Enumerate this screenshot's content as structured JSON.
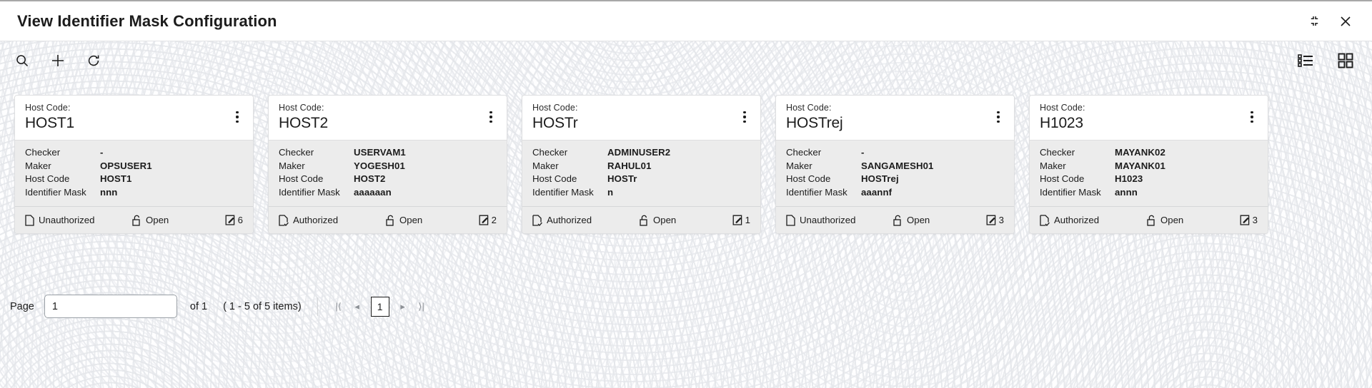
{
  "window": {
    "title": "View Identifier Mask Configuration",
    "actions": [
      {
        "name": "minimize-expand-icon",
        "label": "Minimize"
      },
      {
        "name": "close-icon",
        "label": "Close"
      }
    ]
  },
  "toolbar": {
    "left_tools": [
      {
        "name": "search-icon",
        "label": "Search"
      },
      {
        "name": "add-icon",
        "label": "Add"
      },
      {
        "name": "refresh-icon",
        "label": "Refresh"
      }
    ],
    "right_tools": [
      {
        "name": "list-view-icon",
        "label": "List View"
      },
      {
        "name": "grid-view-icon",
        "label": "Grid View"
      }
    ]
  },
  "cards": {
    "head_label": "Host Code:",
    "field_labels": {
      "checker": "Checker",
      "maker": "Maker",
      "host_code": "Host Code",
      "identifier_mask": "Identifier Mask"
    },
    "items": [
      {
        "title": "HOST1",
        "checker": "-",
        "maker": "OPSUSER1",
        "host_code": "HOST1",
        "identifier_mask": "nnn",
        "status": "Unauthorized",
        "status_icon": "document-icon",
        "lock": "Open",
        "lock_icon": "unlock-icon",
        "version": "6",
        "version_icon": "edit-icon"
      },
      {
        "title": "HOST2",
        "checker": "USERVAM1",
        "maker": "YOGESH01",
        "host_code": "HOST2",
        "identifier_mask": "aaaaaan",
        "status": "Authorized",
        "status_icon": "document-check-icon",
        "lock": "Open",
        "lock_icon": "unlock-icon",
        "version": "2",
        "version_icon": "edit-icon"
      },
      {
        "title": "HOSTr",
        "checker": "ADMINUSER2",
        "maker": "RAHUL01",
        "host_code": "HOSTr",
        "identifier_mask": "n",
        "status": "Authorized",
        "status_icon": "document-check-icon",
        "lock": "Open",
        "lock_icon": "unlock-icon",
        "version": "1",
        "version_icon": "edit-icon"
      },
      {
        "title": "HOSTrej",
        "checker": "-",
        "maker": "SANGAMESH01",
        "host_code": "HOSTrej",
        "identifier_mask": "aaannf",
        "status": "Unauthorized",
        "status_icon": "document-icon",
        "lock": "Open",
        "lock_icon": "unlock-icon",
        "version": "3",
        "version_icon": "edit-icon"
      },
      {
        "title": "H1023",
        "checker": "MAYANK02",
        "maker": "MAYANK01",
        "host_code": "H1023",
        "identifier_mask": "annn",
        "status": "Authorized",
        "status_icon": "document-check-icon",
        "lock": "Open",
        "lock_icon": "unlock-icon",
        "version": "3",
        "version_icon": "edit-icon"
      }
    ]
  },
  "pagination": {
    "page_label": "Page",
    "page_value": "1",
    "of_text": "of 1",
    "items_text": "( 1 - 5 of 5 items)",
    "current_page": "1",
    "nav": {
      "first": "|⟨",
      "prev": "◂",
      "next": "▸",
      "last": "⟩|"
    }
  },
  "colors": {
    "card_body_bg": "#ececec",
    "card_border": "#dedfe1",
    "text": "#1c1c1c"
  }
}
